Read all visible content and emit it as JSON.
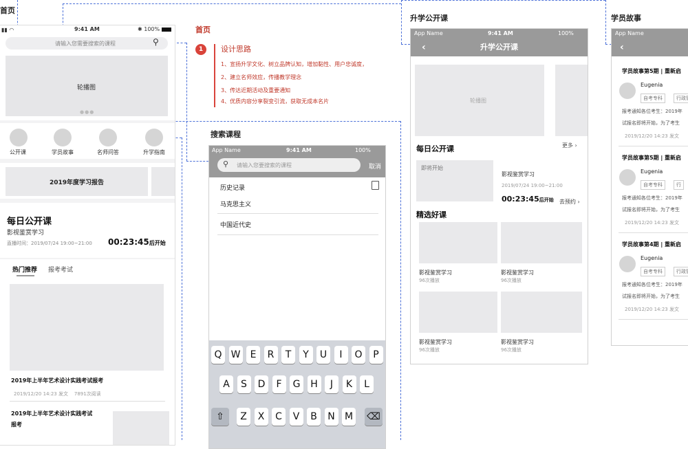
{
  "frames": {
    "home": "首页",
    "public_course": "升学公开课",
    "stories": "学员故事",
    "search": "搜索课程"
  },
  "status": {
    "time": "9:41 AM",
    "battery": "100%",
    "app": "App Name"
  },
  "home": {
    "search_placeholder": "请输入您需要搜索的课程",
    "banner": "轮播图",
    "nav": [
      "公开课",
      "学员故事",
      "名师问答",
      "升学指南"
    ],
    "report_card": "2019年度学习报告",
    "daily_title": "每日公开课",
    "daily_sub": "影视鉴赏学习",
    "live_time": "直播时间：2019/07/24 19:00~21:00",
    "countdown": "00:23:45",
    "countdown_suffix": "后开始",
    "tabs": [
      "热门推荐",
      "报考考试"
    ],
    "article1_title": "2019年上半年艺术设计实践考试报考",
    "article1_meta": "2019/12/20 14:23 发文    7891次阅读",
    "article2_title_l1": "2019年上半年艺术设计实践考试",
    "article2_title_l2": "报考"
  },
  "notes": {
    "title": "首页",
    "badge": "1",
    "heading": "设计思路",
    "items": [
      "1、宣扬升学文化、树立品牌认知，增加黏性、用户忠诚度，",
      "2、建立名师效应，传播教学理念",
      "3、传达近期活动及重要通知",
      "4、优质内容分享裂变引流，获取无成本名片"
    ]
  },
  "search": {
    "placeholder": "请输入您要搜索的课程",
    "cancel": "取消",
    "history_label": "历史记录",
    "history": [
      "马克思主义",
      "中国近代史"
    ],
    "keys_row1": [
      "Q",
      "W",
      "E",
      "R",
      "T",
      "Y",
      "U",
      "I",
      "O",
      "P"
    ],
    "keys_row2": [
      "A",
      "S",
      "D",
      "F",
      "G",
      "H",
      "J",
      "K",
      "L"
    ],
    "keys_row3": [
      "Z",
      "X",
      "C",
      "V",
      "B",
      "N",
      "M"
    ]
  },
  "public_course": {
    "title": "升学公开课",
    "banner": "轮播图",
    "daily": "每日公开课",
    "more": "更多",
    "upcoming": "即将开始",
    "course": "影视鉴赏学习",
    "time": "2019/07/24 19:00~21:00",
    "countdown": "00:23:45",
    "countdown_suffix": "后开始",
    "book": "去预约",
    "featured": "精选好课",
    "cards": [
      {
        "title": "影视鉴赏学习",
        "plays": "96次播放"
      },
      {
        "title": "影视鉴赏学习",
        "plays": "96次播放"
      },
      {
        "title": "影视鉴赏学习",
        "plays": "96次播放"
      },
      {
        "title": "影视鉴赏学习",
        "plays": "96次播放"
      }
    ]
  },
  "stories": {
    "posts": [
      {
        "title": "学员故事第5期 | 重新启",
        "name": "Eugenia",
        "tags": [
          "自考专科",
          "行政管"
        ],
        "text1": "报考通知各位考生：2019年",
        "text2": "试报名即将开始，为了考生",
        "meta": "2019/12/20 14:23 发文"
      },
      {
        "title": "学员故事第5期 | 重新启",
        "name": "Eugenia",
        "tags": [
          "自考专科",
          "行"
        ],
        "text1": "报考通知各位考生：2019年",
        "text2": "试报名即将开始，为了考生",
        "meta": "2019/12/20 14:23 发文"
      },
      {
        "title": "学员故事第4期 | 重新启",
        "name": "Eugenia",
        "tags": [
          "自考专科",
          "行政管"
        ],
        "text1": "报考通知各位考生：2019年",
        "text2": "试报名即将开始，为了考生",
        "meta": "2019/12/20 14:23 发文"
      }
    ]
  }
}
